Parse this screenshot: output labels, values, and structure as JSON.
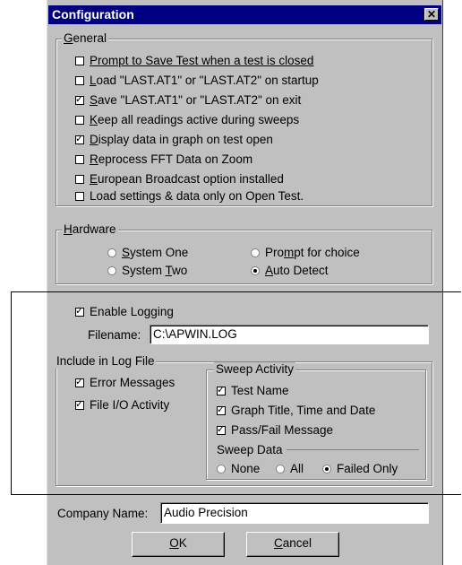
{
  "window": {
    "title": "Configuration",
    "close_glyph": "✕"
  },
  "general": {
    "legend_hot": "G",
    "legend_rest": "eneral",
    "items": [
      {
        "hot": "P",
        "rest": "rompt to Save Test  when a test is closed",
        "checked": false
      },
      {
        "hot": "L",
        "rest": "oad \"LAST.AT1\" or \"LAST.AT2\" on startup",
        "checked": false
      },
      {
        "hot": "S",
        "rest": "ave \"LAST.AT1\" or \"LAST.AT2\" on exit",
        "checked": true
      },
      {
        "hot": "K",
        "rest": "eep all readings active during sweeps",
        "checked": false
      },
      {
        "hot": "D",
        "rest": "isplay data in graph on test open",
        "checked": true
      },
      {
        "hot": "R",
        "rest": "eprocess FFT Data on Zoom",
        "checked": false
      },
      {
        "hot": "E",
        "rest": "uropean Broadcast option installed",
        "checked": false
      },
      {
        "hot": "",
        "rest": "Load settings & data only on Open Test.",
        "checked": false
      }
    ]
  },
  "hardware": {
    "legend_hot": "H",
    "legend_rest": "ardware",
    "system_one": {
      "pre": "",
      "hot": "S",
      "rest": "ystem One",
      "checked": false
    },
    "system_two": {
      "pre": "System ",
      "hot": "T",
      "rest": "wo",
      "checked": false
    },
    "prompt": {
      "pre": "Pro",
      "hot": "m",
      "rest": "pt for choice",
      "checked": false
    },
    "auto": {
      "pre": "",
      "hot": "A",
      "rest": "uto Detect",
      "checked": true
    }
  },
  "logging": {
    "enable_label": "Enable Logging",
    "enable_checked": true,
    "filename_label": "Filename:",
    "filename_value": "C:\\APWIN.LOG",
    "include_legend": "Include in Log File",
    "error_messages": "Error Messages",
    "file_io": "File I/O Activity",
    "sweep_activity_legend": "Sweep Activity",
    "test_name": "Test Name",
    "graph_title": "Graph Title, Time and Date",
    "pass_fail": "Pass/Fail Message",
    "sweep_data_legend": "Sweep Data",
    "none": "None",
    "all": "All",
    "failed_only": "Failed Only"
  },
  "company": {
    "label": "Company Name:",
    "value": "Audio Precision"
  },
  "buttons": {
    "ok_hot": "O",
    "ok_rest": "K",
    "cancel_hot": "C",
    "cancel_rest": "ancel"
  }
}
